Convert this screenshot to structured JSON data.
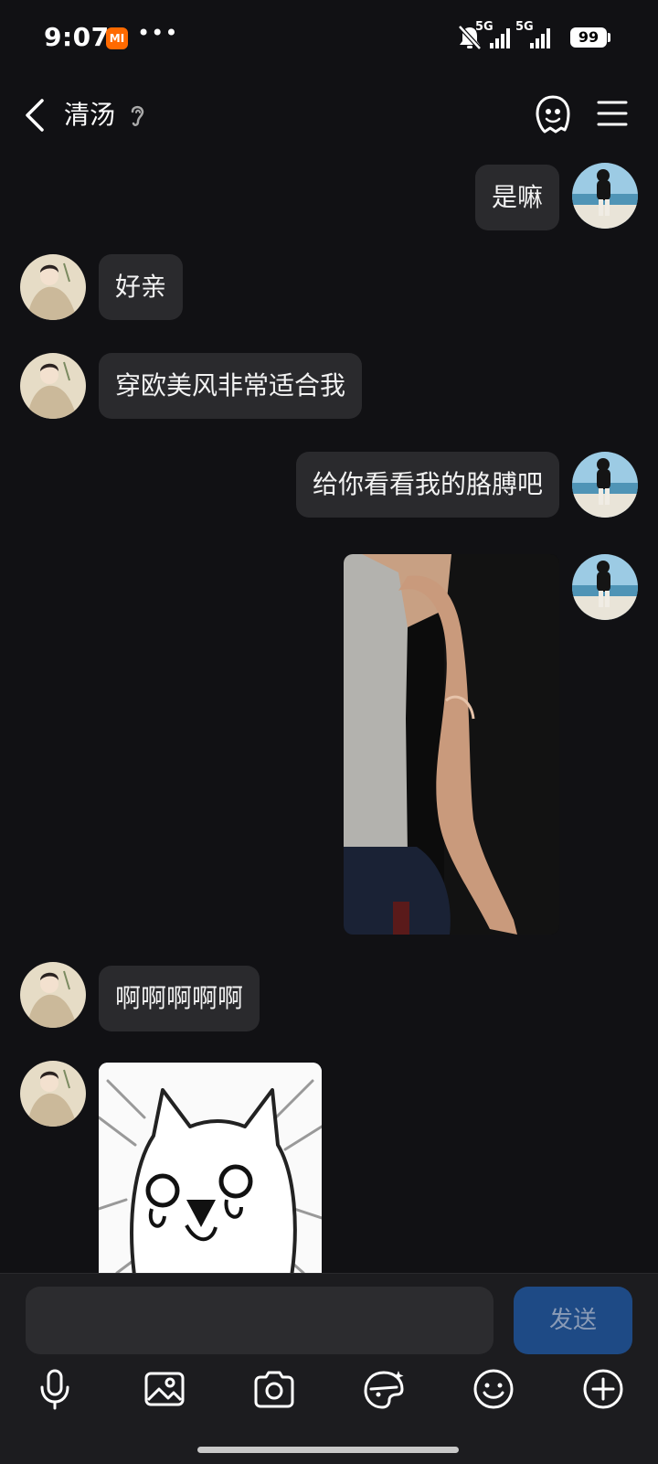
{
  "status_bar": {
    "time": "9:07",
    "app_badge": "MI",
    "more_dots": "•••",
    "network_1": "5G",
    "network_2": "5G",
    "battery": "99"
  },
  "header": {
    "title": "清汤"
  },
  "messages": [
    {
      "side": "self",
      "type": "text",
      "text": "是嘛"
    },
    {
      "side": "other",
      "type": "text",
      "text": "好亲"
    },
    {
      "side": "other",
      "type": "text",
      "text": "穿欧美风非常适合我"
    },
    {
      "side": "self",
      "type": "text",
      "text": "给你看看我的胳膊吧"
    },
    {
      "side": "self",
      "type": "image",
      "icon": "arm-photo"
    },
    {
      "side": "other",
      "type": "text",
      "text": "啊啊啊啊啊"
    },
    {
      "side": "other",
      "type": "image",
      "icon": "crying-cat-sticker"
    }
  ],
  "composer": {
    "placeholder": "",
    "send_label": "发送"
  },
  "toolbar_icons": [
    "microphone-icon",
    "gallery-icon",
    "camera-icon",
    "sticker-icon",
    "emoji-icon",
    "plus-icon"
  ],
  "colors": {
    "background": "#111114",
    "bubble": "#2a2a2d",
    "send_button": "#1e4a85",
    "badge": "#ff6a00"
  }
}
